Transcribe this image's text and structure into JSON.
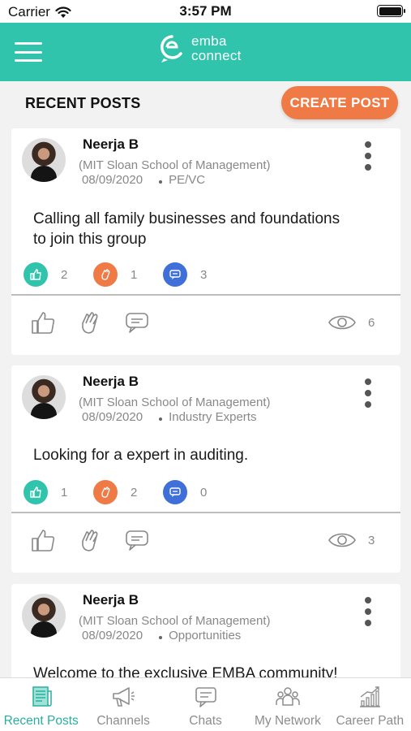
{
  "status_bar": {
    "carrier": "Carrier",
    "time": "3:57 PM",
    "battery_level": 1.0
  },
  "header": {
    "brand_line1": "emba",
    "brand_line2": "connect",
    "accent_color": "#2fc4ab"
  },
  "subheader": {
    "title": "RECENT POSTS",
    "create_label": "CREATE POST",
    "create_color": "#f07a45"
  },
  "posts": [
    {
      "author": "Neerja B",
      "school": "(MIT Sloan School of Management)",
      "date": "08/09/2020",
      "category": "PE/VC",
      "content_line1": "Calling all family businesses and foundations",
      "content_line2": "to join this group",
      "likes": "2",
      "claps": "1",
      "comments": "3",
      "views": "6"
    },
    {
      "author": "Neerja B",
      "school": "(MIT Sloan School of Management)",
      "date": "08/09/2020",
      "category": "Industry Experts",
      "content_line1": "Looking for a expert in auditing.",
      "likes": "1",
      "claps": "2",
      "comments": "0",
      "views": "3"
    },
    {
      "author": "Neerja B",
      "school": "(MIT Sloan School of Management)",
      "date": "08/09/2020",
      "category": "Opportunities",
      "content_line1": "Welcome to the exclusive EMBA community!"
    }
  ],
  "tabs": [
    {
      "label": "Recent Posts",
      "icon": "newspaper-icon",
      "active": true
    },
    {
      "label": "Channels",
      "icon": "megaphone-icon",
      "active": false
    },
    {
      "label": "Chats",
      "icon": "chat-icon",
      "active": false
    },
    {
      "label": "My Network",
      "icon": "people-icon",
      "active": false
    },
    {
      "label": "Career Path",
      "icon": "bar-chart-icon",
      "active": false
    }
  ],
  "colors": {
    "like": "#2fc4ab",
    "clap": "#f07a45",
    "comment": "#3f6fd8",
    "active_tab": "#2aaea0"
  }
}
